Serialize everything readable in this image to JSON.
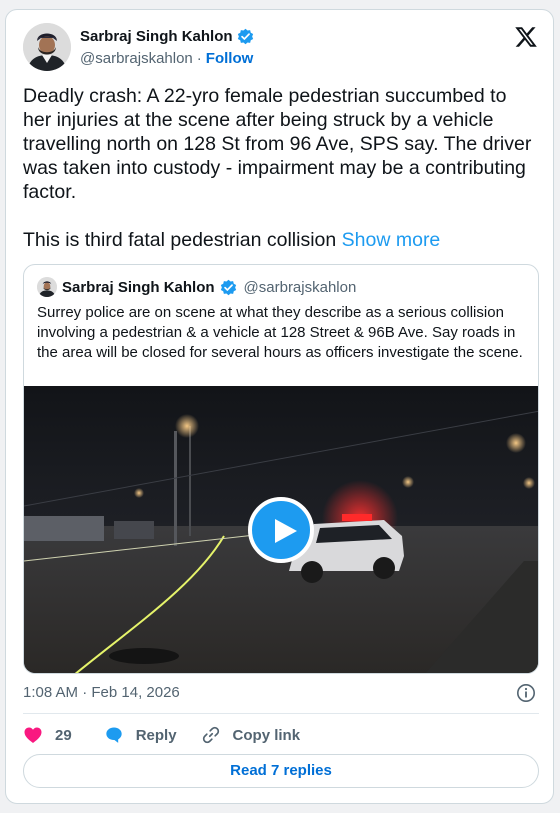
{
  "author": {
    "name": "Sarbraj Singh Kahlon",
    "handle": "@sarbrajskahlon",
    "separator": "·",
    "follow_label": "Follow"
  },
  "tweet": {
    "paragraph_1": "Deadly crash: A 22-yro female pedestrian succumbed to her injuries at the scene after being struck by a vehicle travelling north on 128 St from 96 Ave, SPS say. The driver was taken into custody - impairment may be a contributing factor.",
    "paragraph_2": "This is third fatal pedestrian collision",
    "show_more_label": "Show more"
  },
  "quote": {
    "name": "Sarbraj Singh Kahlon",
    "handle": "@sarbrajskahlon",
    "text": "Surrey police are on scene at what they describe as a serious collision involving a pedestrian & a vehicle at 128 Street & 96B Ave. Say roads in the area will be closed for several hours as officers investigate the scene."
  },
  "meta": {
    "timestamp": "1:08 AM · Feb 14, 2026"
  },
  "actions": {
    "like_count": "29",
    "reply_label": "Reply",
    "copy_link_label": "Copy link"
  },
  "replies_button_label": "Read 7 replies",
  "icons": {
    "logo": "x-logo-icon",
    "verified": "verified-badge-icon",
    "info": "info-icon",
    "like": "heart-icon",
    "reply": "speech-bubble-icon",
    "copy": "link-icon",
    "play": "play-icon"
  },
  "colors": {
    "accent_link": "#006fd6",
    "show_more": "#1d9bf0",
    "verified": "#1d9bf0",
    "like": "#f91880",
    "reply": "#1d9bf0",
    "text_secondary": "#536471"
  }
}
